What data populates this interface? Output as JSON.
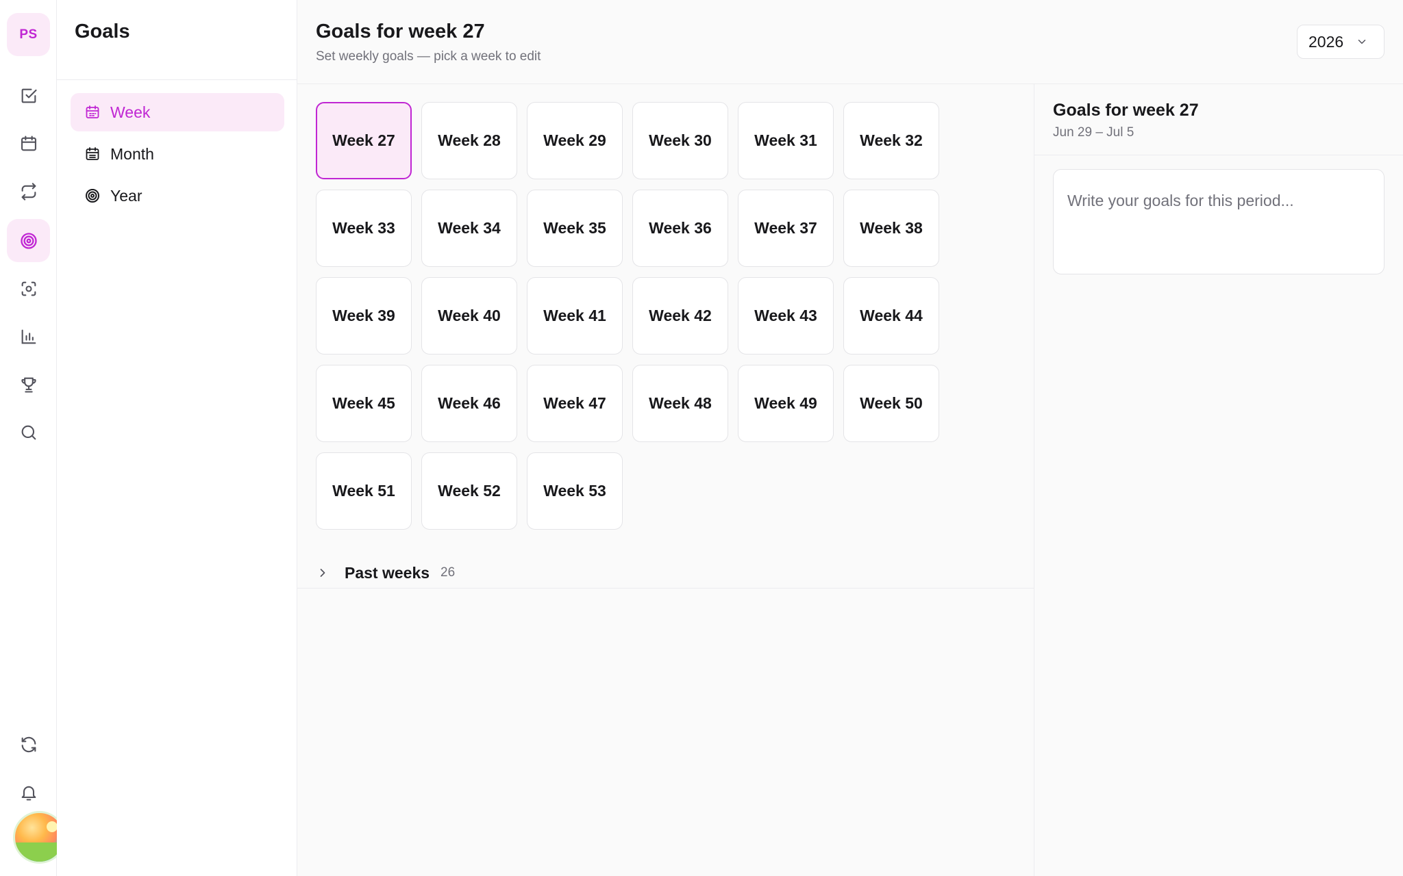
{
  "rail": {
    "initials": "PS",
    "items": [
      {
        "name": "tasks",
        "icon": "check-square-icon"
      },
      {
        "name": "calendar",
        "icon": "calendar-icon"
      },
      {
        "name": "habits",
        "icon": "repeat-icon"
      },
      {
        "name": "goals",
        "icon": "target-icon",
        "active": true
      },
      {
        "name": "focus",
        "icon": "focus-icon"
      },
      {
        "name": "stats",
        "icon": "bar-chart-icon"
      },
      {
        "name": "achievements",
        "icon": "trophy-icon"
      },
      {
        "name": "search",
        "icon": "search-icon"
      },
      {
        "name": "sync",
        "icon": "refresh-icon"
      },
      {
        "name": "notifications",
        "icon": "bell-icon"
      }
    ]
  },
  "sidebar": {
    "title": "Goals",
    "items": [
      {
        "label": "Week",
        "icon": "calendar-icon",
        "active": true
      },
      {
        "label": "Month",
        "icon": "calendar-month-icon"
      },
      {
        "label": "Year",
        "icon": "target-icon"
      }
    ]
  },
  "header": {
    "title": "Goals for week 27",
    "subtitle": "Set weekly goals — pick a week to edit",
    "year": "2026"
  },
  "weeks": {
    "selected": "Week 27",
    "items": [
      "Week 27",
      "Week 28",
      "Week 29",
      "Week 30",
      "Week 31",
      "Week 32",
      "Week 33",
      "Week 34",
      "Week 35",
      "Week 36",
      "Week 37",
      "Week 38",
      "Week 39",
      "Week 40",
      "Week 41",
      "Week 42",
      "Week 43",
      "Week 44",
      "Week 45",
      "Week 46",
      "Week 47",
      "Week 48",
      "Week 49",
      "Week 50",
      "Week 51",
      "Week 52",
      "Week 53"
    ]
  },
  "past_weeks": {
    "label": "Past weeks",
    "count": "26"
  },
  "panel": {
    "title": "Goals for week 27",
    "range": "Jun 29 – Jul 5",
    "placeholder": "Write your goals for this period..."
  },
  "colors": {
    "accent": "#c026d3",
    "accent_bg": "#fbeaf8"
  }
}
